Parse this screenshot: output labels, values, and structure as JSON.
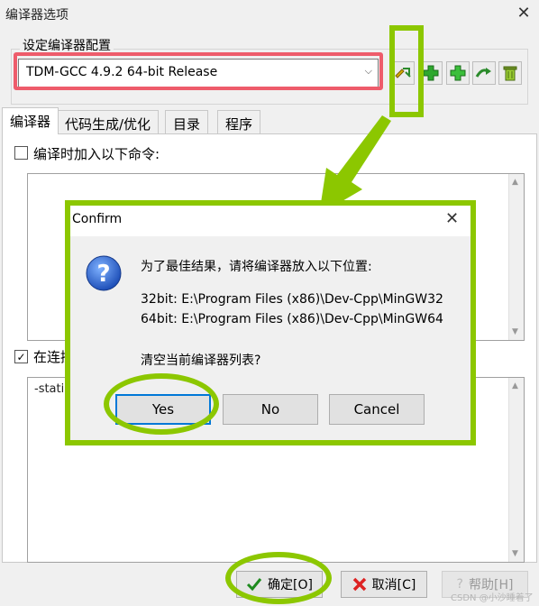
{
  "window": {
    "title": "编译器选项",
    "close": "✕"
  },
  "config": {
    "group_label": "设定编译器配置",
    "selected_compiler": "TDM-GCC 4.9.2 64-bit Release"
  },
  "tabs": [
    {
      "label": "编译器"
    },
    {
      "label": "代码生成/优化"
    },
    {
      "label": "目录"
    },
    {
      "label": "程序"
    }
  ],
  "compiler_tab": {
    "checkbox1_label": "编译时加入以下命令:",
    "checkbox2_label": "在连接器命令行加入以下命令",
    "checkbox2_checked": true,
    "linker_text": "-static-libgcc"
  },
  "buttons": {
    "ok": "确定[O]",
    "cancel": "取消[C]",
    "help": "帮助[H]"
  },
  "dialog": {
    "title": "Confirm",
    "close": "✕",
    "message": "为了最佳结果，请将编译器放入以下位置:",
    "path32": "32bit: E:\\Program Files (x86)\\Dev-Cpp\\MinGW32",
    "path64": "64bit: E:\\Program Files (x86)\\Dev-Cpp\\MinGW64",
    "question": "清空当前编译器列表?",
    "yes": "Yes",
    "no": "No",
    "cancel": "Cancel"
  },
  "watermark": "CSDN @小沙睡着了",
  "colors": {
    "highlight_green": "#8cc700",
    "highlight_red": "#ee5c6b",
    "focus_blue": "#0078d7"
  }
}
